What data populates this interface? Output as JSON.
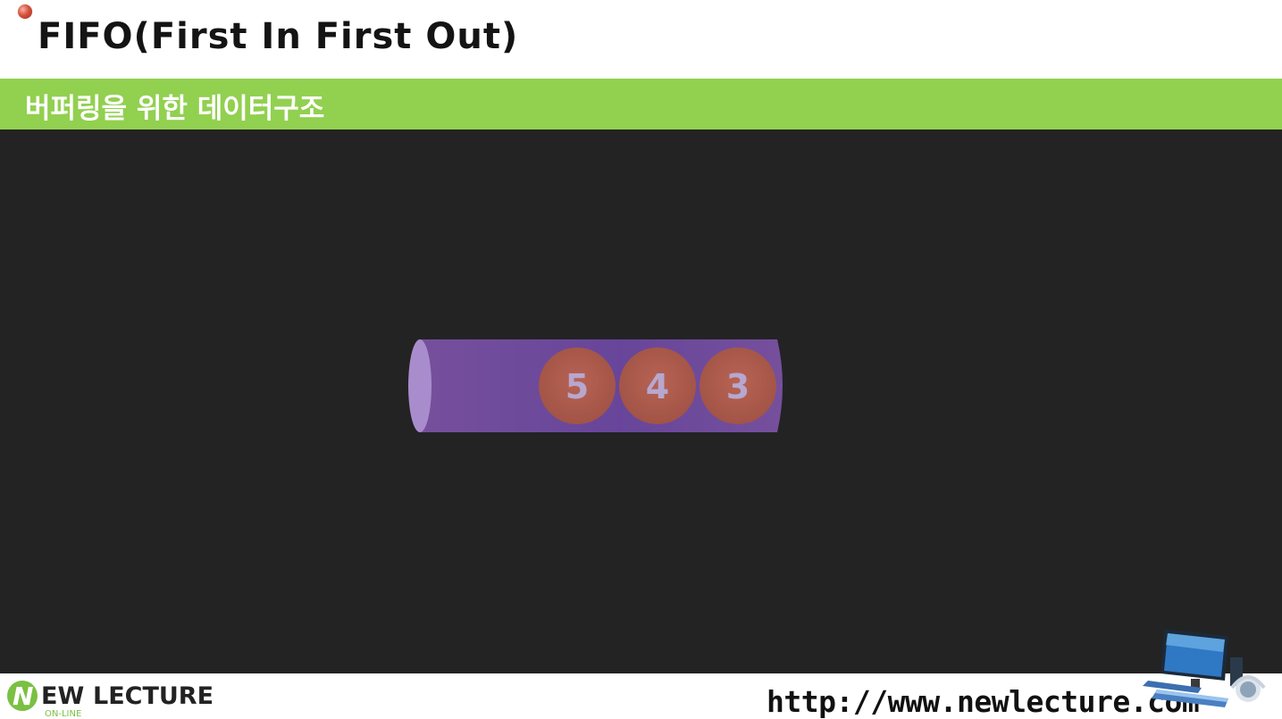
{
  "slide": {
    "title": "FIFO(First In First Out)",
    "subtitle": "버퍼링을 위한 데이터구조"
  },
  "queue": {
    "items": [
      {
        "label": "5"
      },
      {
        "label": "4"
      },
      {
        "label": "3"
      }
    ],
    "colors": {
      "tube": "#7a52a3",
      "tube_end": "#a98ccc",
      "ball": "#b05c4a",
      "ball_text": "#b7a7cf",
      "background": "#232323"
    }
  },
  "footer": {
    "logo_mark": "N",
    "logo_word1": "EW",
    "logo_word2": "LECTURE",
    "logo_sub": "ON-LINE",
    "url": "http://www.newlecture.com",
    "accent": "#7ac043"
  },
  "colors": {
    "subtitle_bar": "#92d050"
  }
}
